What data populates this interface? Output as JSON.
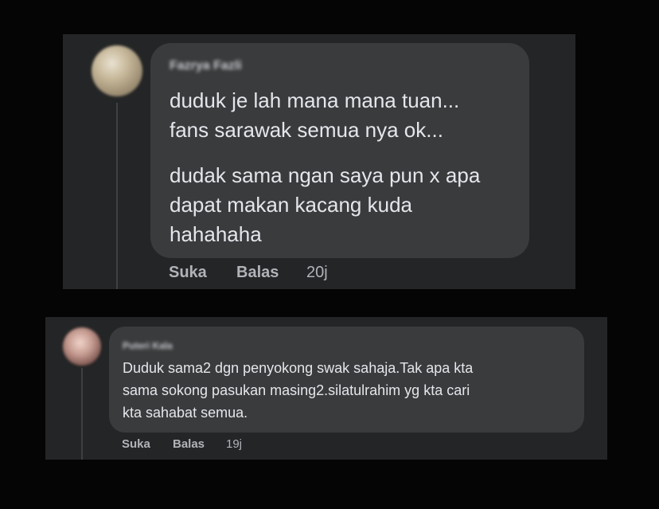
{
  "comments": [
    {
      "author": "Fazrya Fazli",
      "paragraphs": [
        "duduk je lah mana mana tuan...\nfans sarawak semua nya ok...",
        "dudak sama ngan saya pun x apa\ndapat makan kacang kuda\nhahahaha"
      ],
      "actions": {
        "like": "Suka",
        "reply": "Balas",
        "time": "20j"
      }
    },
    {
      "author": "Puteri Kala",
      "paragraphs": [
        "Duduk sama2 dgn penyokong swak sahaja.Tak apa kta\nsama sokong pasukan masing2.silatulrahim yg kta cari\nkta sahabat semua."
      ],
      "actions": {
        "like": "Suka",
        "reply": "Balas",
        "time": "19j"
      }
    }
  ],
  "colors": {
    "background": "#050505",
    "panel": "#242526",
    "bubble": "#3a3b3c",
    "text": "#e4e6eb",
    "secondary_text": "#b0b3b8"
  }
}
